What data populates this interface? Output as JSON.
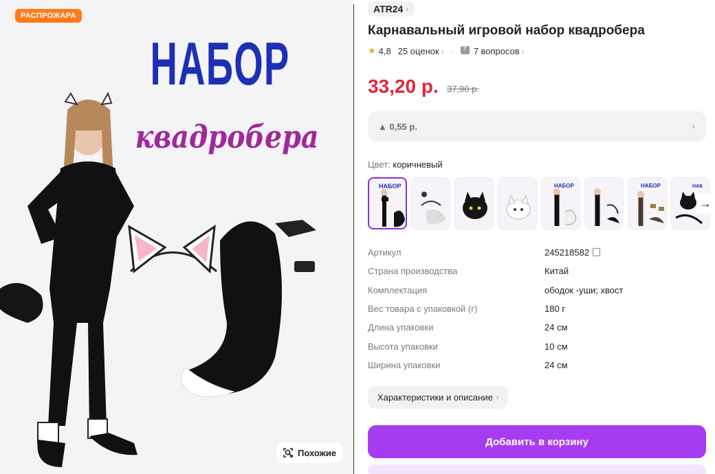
{
  "hero": {
    "badge": "РАСПРОЖАРА",
    "title_line1": "НАБОР",
    "title_line2": "квадробера",
    "similar_label": "Похожие",
    "similar_icon": "search-similar-icon"
  },
  "product": {
    "brand": "ATR24",
    "title": "Карнавальный игровой набор квадробера",
    "rating": "4,8",
    "reviews": "25 оценок",
    "questions": "7 вопросов",
    "price": "33,20 р.",
    "old_price": "37,90 р.",
    "price_delta": "▲ 0,55 р.",
    "color_label": "Цвет:",
    "color_value": "коричневый",
    "thumbnails": [
      {
        "name": "thumb-1",
        "active": true
      },
      {
        "name": "thumb-2",
        "active": false
      },
      {
        "name": "thumb-3",
        "active": false
      },
      {
        "name": "thumb-4",
        "active": false
      },
      {
        "name": "thumb-5",
        "active": false
      },
      {
        "name": "thumb-6",
        "active": false
      },
      {
        "name": "thumb-7",
        "active": false
      },
      {
        "name": "thumb-8",
        "active": false
      }
    ],
    "specs": [
      {
        "key": "Артикул",
        "value": "245218582"
      },
      {
        "key": "Страна производства",
        "value": "Китай"
      },
      {
        "key": "Комплектация",
        "value": "ободок -уши; хвост"
      },
      {
        "key": "Вес товара с упаковкой (г)",
        "value": "180 г"
      },
      {
        "key": "Длина упаковки",
        "value": "24 см"
      },
      {
        "key": "Высота упаковки",
        "value": "10 см"
      },
      {
        "key": "Ширина упаковки",
        "value": "24 см"
      }
    ],
    "description_button": "Характеристики и описание",
    "add_to_cart": "Добавить в корзину"
  },
  "colors": {
    "accent": "#a63cf0",
    "price": "#e0263c",
    "badge": "#ff7a1a",
    "hero_title": "#1d2fb5",
    "hero_subtitle": "#a0289a"
  }
}
